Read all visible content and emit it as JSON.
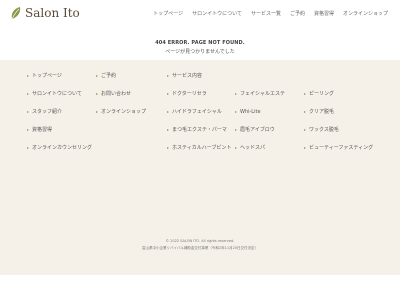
{
  "header": {
    "logo_text": "Salon Ito",
    "nav": [
      "トップページ",
      "サロンイトウについて",
      "サービス一覧",
      "ご予約",
      "資格習得",
      "オンラインショップ"
    ]
  },
  "error": {
    "title": "404 ERROR. PAGE NOT FOUND.",
    "message": "ページが見つかりませんでした"
  },
  "footer": {
    "columns": [
      [
        "トップページ",
        "サロンイトウについて",
        "スタッフ紹介",
        "資格習得",
        "オンラインカウンセリング"
      ],
      [
        "ご予約",
        "お問い合わせ",
        "オンラインショップ"
      ],
      [
        "サービス内容",
        "ドクターリセラ",
        "ハイドラフェイシャル",
        "まつ毛エクステ・パーマ",
        "ホスティカルハーブピント"
      ],
      [
        "フェイシャルエステ",
        "Whi-Lite",
        "眉毛アイブロウ",
        "ヘッドスパ"
      ],
      [
        "ピーリング",
        "クリア脱毛",
        "ワックス脱毛",
        "ビューティーファスティング"
      ]
    ],
    "copyright": "© 2022 SALON ITO. All rights reserved.",
    "license": "富山県中小企業リバイバル補助金交付事業（令和2年11月20日交付決定）"
  },
  "colors": {
    "footer_bg": "#f5f1e8",
    "bullet": "#8a9a5a",
    "logo_leaf": "#8a9a4a",
    "logo_text": "#5a4a3a"
  }
}
